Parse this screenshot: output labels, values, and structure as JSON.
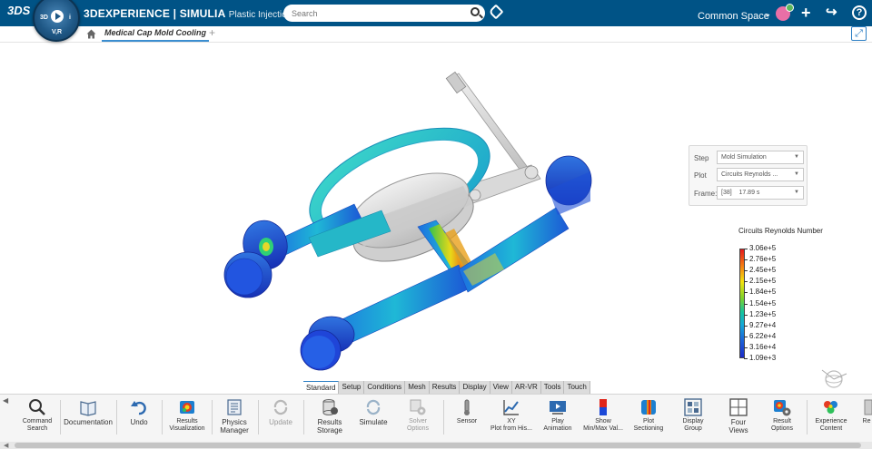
{
  "app": {
    "brand_bold": "3DEXPERIENCE | SIMULIA",
    "brand_app": "Plastic Injection",
    "compass_labels": {
      "left": "3D",
      "right": "i",
      "bottom": "V,R"
    },
    "search_placeholder": "Search",
    "space_label": "Common Space",
    "colors": {
      "topbar": "#005386",
      "accent": "#2d7fc4",
      "avatar": "#e86fa6"
    }
  },
  "tabs": {
    "document_title": "Medical Cap Mold Cooling",
    "add_tab": "+"
  },
  "step_panel": {
    "step": {
      "label": "Step",
      "value": "Mold Simulation"
    },
    "plot": {
      "label": "Plot",
      "value": "Circuits Reynolds ..."
    },
    "frame": {
      "label": "Frame:",
      "value": "[38]    17.89 s"
    }
  },
  "legend": {
    "title": "Circuits Reynolds Number",
    "values": [
      "3.06e+5",
      "2.76e+5",
      "2.45e+5",
      "2.15e+5",
      "1.84e+5",
      "1.54e+5",
      "1.23e+5",
      "9.27e+4",
      "6.22e+4",
      "3.16e+4",
      "1.09e+3"
    ]
  },
  "section_tabs": [
    "Standard",
    "Setup",
    "Conditions",
    "Mesh",
    "Results",
    "Display",
    "View",
    "AR-VR",
    "Tools",
    "Touch"
  ],
  "toolbar": {
    "command_search": "Command\nSearch",
    "documentation": "Documentation",
    "undo": "Undo",
    "results_visualization": "Results\nVisualization",
    "physics_manager": "Physics\nManager",
    "update": "Update",
    "results_storage": "Results\nStorage",
    "simulate": "Simulate",
    "solver_options": "Solver\nOptions",
    "sensor": "Sensor",
    "xy_plot": "XY\nPlot from His...",
    "play_animation": "Play\nAnimation",
    "show_minmax": "Show\nMin/Max Val...",
    "plot_sectioning": "Plot\nSectioning",
    "display_group": "Display\nGroup",
    "four_views": "Four\nViews",
    "result_options": "Result\nOptions",
    "experience_content": "Experience\nContent",
    "truncated": "Re"
  }
}
